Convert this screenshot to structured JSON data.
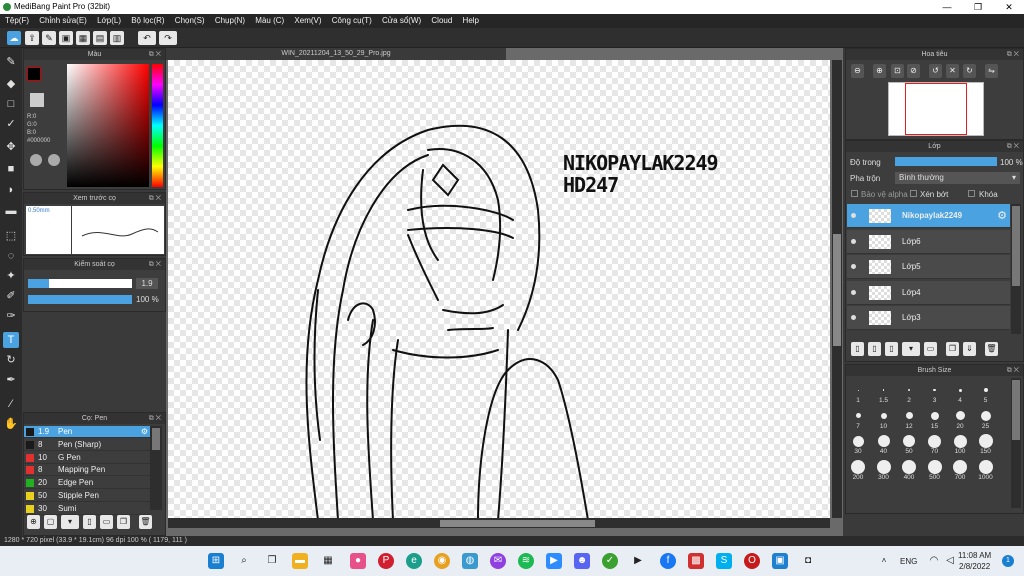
{
  "app": {
    "title": "MediBang Paint Pro (32bit)"
  },
  "window": {
    "min": "—",
    "max": "❐",
    "close": "✕"
  },
  "menu": [
    "Tệp(F)",
    "Chỉnh sửa(E)",
    "Lớp(L)",
    "Bộ lọc(R)",
    "Chọn(S)",
    "Chụp(N)",
    "Màu (C)",
    "Xem(V)",
    "Công cụ(T)",
    "Cửa sổ(W)",
    "Cloud",
    "Help"
  ],
  "colors": {
    "accent": "#4aa3e0",
    "brush_black": "#000000",
    "red": "#e03030",
    "green": "#20b020",
    "yellow": "#e8d020"
  },
  "color_panel": {
    "title": "Màu",
    "r": "R:0",
    "g": "G:0",
    "b": "B:0",
    "hex": "#000000"
  },
  "brush_preview": {
    "title": "Xem trước cọ",
    "size": "0.50mm"
  },
  "brush_control": {
    "title": "Kiểm soát cọ",
    "size_value": "1.9",
    "opacity_value": "100 %",
    "size_level": 0.2,
    "opacity_level": 1.0
  },
  "brush_list": {
    "title": "Cọ: Pen",
    "items": [
      {
        "size": "1.9",
        "name": "Pen",
        "color": "#1a1a1a"
      },
      {
        "size": "8",
        "name": "Pen (Sharp)",
        "color": "#1a1a1a"
      },
      {
        "size": "10",
        "name": "G Pen",
        "color": "#e03030"
      },
      {
        "size": "8",
        "name": "Mapping Pen",
        "color": "#e03030"
      },
      {
        "size": "20",
        "name": "Edge Pen",
        "color": "#20b020"
      },
      {
        "size": "50",
        "name": "Stipple Pen",
        "color": "#e8d020"
      },
      {
        "size": "30",
        "name": "Sumi",
        "color": "#e8d020"
      }
    ]
  },
  "document": {
    "tab": "WIN_20211204_13_50_29_Pro.jpg",
    "text_line1": "NIKOPAYLAK2249",
    "text_line2": "HD247"
  },
  "navigator": {
    "title": "Hoa tiêu"
  },
  "layer_panel": {
    "title": "Lớp",
    "opacity_label": "Độ trong",
    "opacity_value": "100 %",
    "opacity_level": 1.0,
    "blend_label": "Pha trộn",
    "blend_value": "Bình thường",
    "protect_alpha": "Bảo vệ alpha",
    "clipping": "Xén bớt",
    "lock": "Khóa",
    "layers": [
      "Nikopaylak2249",
      "Lớp6",
      "Lớp5",
      "Lớp4",
      "Lớp3"
    ]
  },
  "brush_size": {
    "title": "Brush Size",
    "sizes": [
      "1",
      "1.5",
      "2",
      "3",
      "4",
      "5",
      "7",
      "10",
      "12",
      "15",
      "20",
      "25",
      "30",
      "40",
      "50",
      "70",
      "100",
      "150",
      "200",
      "300",
      "400",
      "500",
      "700",
      "1000"
    ]
  },
  "status": {
    "text": "1280 * 720 pixel  (33.9 * 19.1cm)  96 dpi  100 %  ( 1179, 111 )"
  },
  "taskbar": {
    "lang": "ENG",
    "time": "11:08 AM",
    "date": "2/8/2022"
  }
}
